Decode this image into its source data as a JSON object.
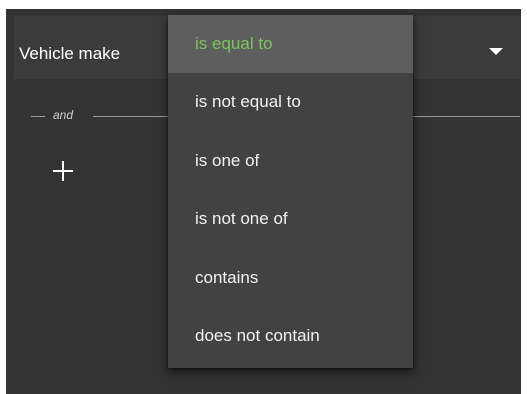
{
  "filter": {
    "field_label": "Vehicle make",
    "conjunction_label": "and"
  },
  "menu": {
    "items": [
      {
        "label": "is equal to",
        "selected": true
      },
      {
        "label": "is not equal to",
        "selected": false
      },
      {
        "label": "is one of",
        "selected": false
      },
      {
        "label": "is not one of",
        "selected": false
      },
      {
        "label": "contains",
        "selected": false
      },
      {
        "label": "does not contain",
        "selected": false
      }
    ]
  },
  "icons": {
    "dropdown": "caret-down-icon",
    "add": "plus-icon"
  },
  "colors": {
    "panel_background": "#333333",
    "menu_background": "#424242",
    "selected_item_background": "#5e5e5e",
    "selected_item_text": "#7cc35d",
    "text": "#f2f2f2"
  }
}
